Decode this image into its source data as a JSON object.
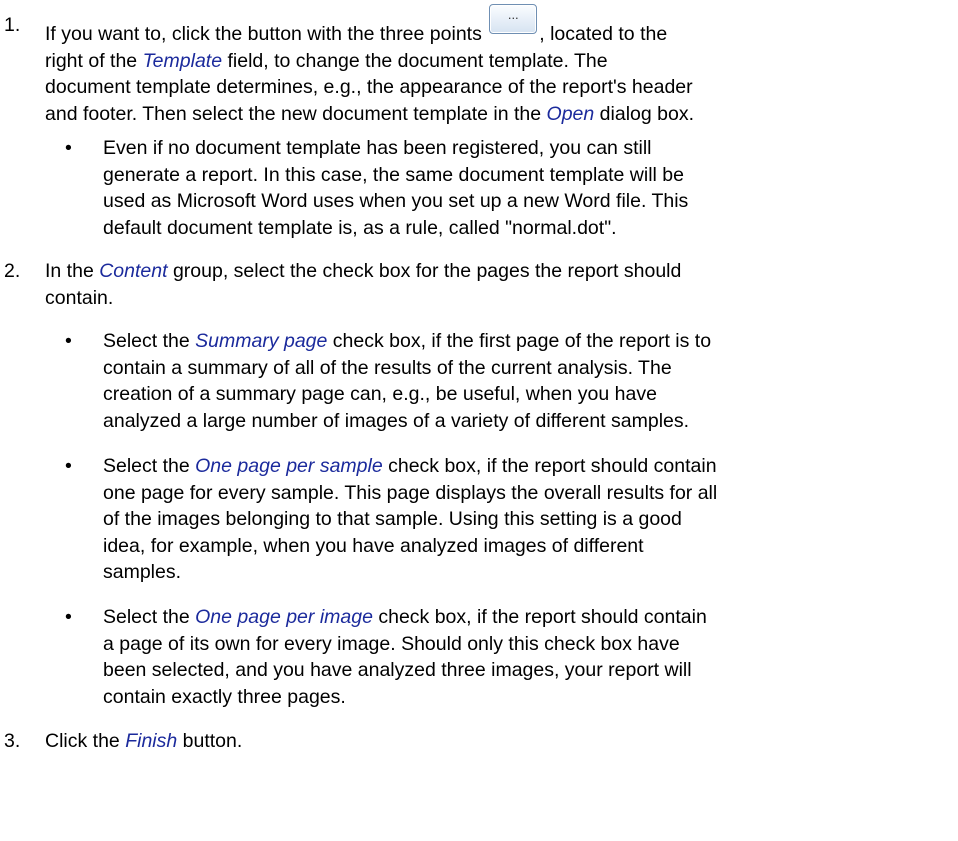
{
  "steps": [
    {
      "number": "1.",
      "line1_a": "If you want to, click the button with the three points ",
      "button_label": "...",
      "line1_b": ", located to the",
      "line2_a": "right of the ",
      "ref_template": "Template",
      "line2_b": " field, to change the document template. The",
      "line3": "document template determines, e.g., the appearance of the report's header",
      "line4_a": "and footer. Then select the new document template in the ",
      "ref_open": "Open",
      "line4_b": " dialog box.",
      "bullets": [
        {
          "lines": [
            "Even if no document template has been registered, you can still",
            "generate a report. In this case, the same document template will be",
            "used as Microsoft Word uses when you set up a new Word file. This",
            "default document template is, as a rule, called \"normal.dot\"."
          ]
        }
      ]
    },
    {
      "number": "2.",
      "line1_a": "In the ",
      "ref_content": "Content",
      "line1_b": " group, select the check box for the pages the report should",
      "line2": "contain.",
      "bullets": [
        {
          "pre": "Select the ",
          "ref": "Summary page",
          "post": " check box, if the first page of the report is to",
          "lines": [
            "contain a summary of all of the results of the current analysis. The",
            "creation of a summary page can, e.g., be useful, when you have",
            "analyzed a large number of images of a variety of different samples."
          ]
        },
        {
          "pre": "Select the ",
          "ref": "One page per sample",
          "post": " check box, if the report should contain",
          "lines": [
            "one page for every sample. This page displays the overall results for all",
            "of the images belonging to that sample. Using this setting is a good",
            "idea, for example, when you have analyzed images of different",
            "samples."
          ]
        },
        {
          "pre": "Select the ",
          "ref": "One page per image",
          "post": " check box, if the report should contain",
          "lines": [
            "a page of its own for every image. Should only this check box have",
            "been selected, and you have analyzed three images, your report will",
            "contain exactly three pages."
          ]
        }
      ]
    },
    {
      "number": "3.",
      "pre": "Click the ",
      "ref_finish": "Finish",
      "post": " button."
    }
  ],
  "bullet_glyph": "•",
  "colors": {
    "reference_text": "#1b2a9c",
    "body_text": "#000000"
  }
}
